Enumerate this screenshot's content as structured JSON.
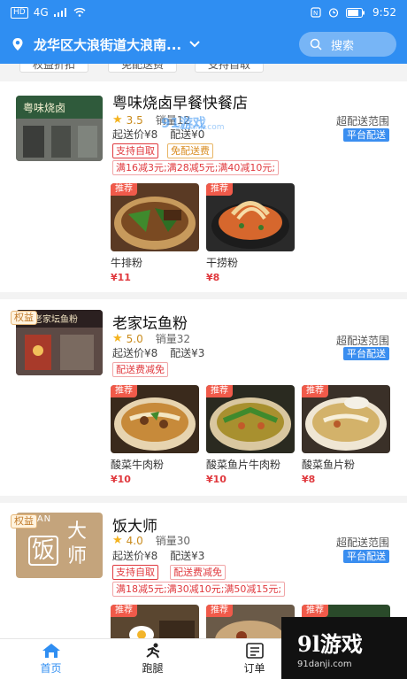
{
  "status": {
    "left_badge": "HD",
    "signal": "4G",
    "time": "9:52"
  },
  "header": {
    "address": "龙华区大浪街道大浪南...",
    "search_label": "搜索"
  },
  "filters": [
    "权益折扣",
    "免配送费",
    "支持自取"
  ],
  "shops": [
    {
      "name": "粤味烧卤早餐快餐店",
      "rating": "3.5",
      "sales": "销量12",
      "min_price": "起送价¥8",
      "delivery": "配送¥0",
      "range": "超配送范围",
      "platform": "平台配送",
      "quanyi": "",
      "tags": [
        "支持自取",
        "免配送费"
      ],
      "discount": "满16减3元;满28减5元;满40减10元;",
      "dishes": [
        {
          "badge": "推荐",
          "name": "牛排粉",
          "price": "¥11"
        },
        {
          "badge": "推荐",
          "name": "干捞粉",
          "price": "¥8"
        }
      ]
    },
    {
      "name": "老家坛鱼粉",
      "rating": "5.0",
      "sales": "销量32",
      "min_price": "起送价¥8",
      "delivery": "配送¥3",
      "range": "超配送范围",
      "platform": "平台配送",
      "quanyi": "权益",
      "tags": [
        "配送费减免"
      ],
      "discount": "",
      "dishes": [
        {
          "badge": "推荐",
          "name": "酸菜牛肉粉",
          "price": "¥10"
        },
        {
          "badge": "推荐",
          "name": "酸菜鱼片牛肉粉",
          "price": "¥10"
        },
        {
          "badge": "推荐",
          "name": "酸菜鱼片粉",
          "price": "¥8"
        }
      ]
    },
    {
      "name": "饭大师",
      "rating": "4.0",
      "sales": "销量30",
      "min_price": "起送价¥8",
      "delivery": "配送¥3",
      "range": "超配送范围",
      "platform": "平台配送",
      "quanyi": "权益",
      "logo_text_top": "FAN",
      "logo_text_main": "饭",
      "logo_text_side": "大师",
      "tags": [
        "支持自取",
        "配送费减免"
      ],
      "discount": "满18减5元;满30减10元;满50减15元;",
      "dishes": [
        {
          "badge": "推荐",
          "name": "",
          "price": ""
        },
        {
          "badge": "推荐",
          "name": "",
          "price": ""
        },
        {
          "badge": "推荐",
          "name": "",
          "price": ""
        }
      ]
    }
  ],
  "shop1_signboard": "粤味烧卤",
  "shop2_signboard": "老家坛鱼粉",
  "tabs": [
    {
      "label": "首页",
      "icon": "home-icon",
      "active": true
    },
    {
      "label": "跑腿",
      "icon": "runner-icon",
      "active": false
    },
    {
      "label": "订单",
      "icon": "order-icon",
      "active": false
    },
    {
      "label": "",
      "icon": "",
      "active": false
    }
  ],
  "watermark": {
    "main": "9l游戏",
    "sub": "91danji.com",
    "overlay": "91游戏",
    "overlay_sub": "91danji.com"
  },
  "colors": {
    "primary": "#2f8ef2",
    "red": "#e0393e",
    "gold": "#f4b31f"
  }
}
